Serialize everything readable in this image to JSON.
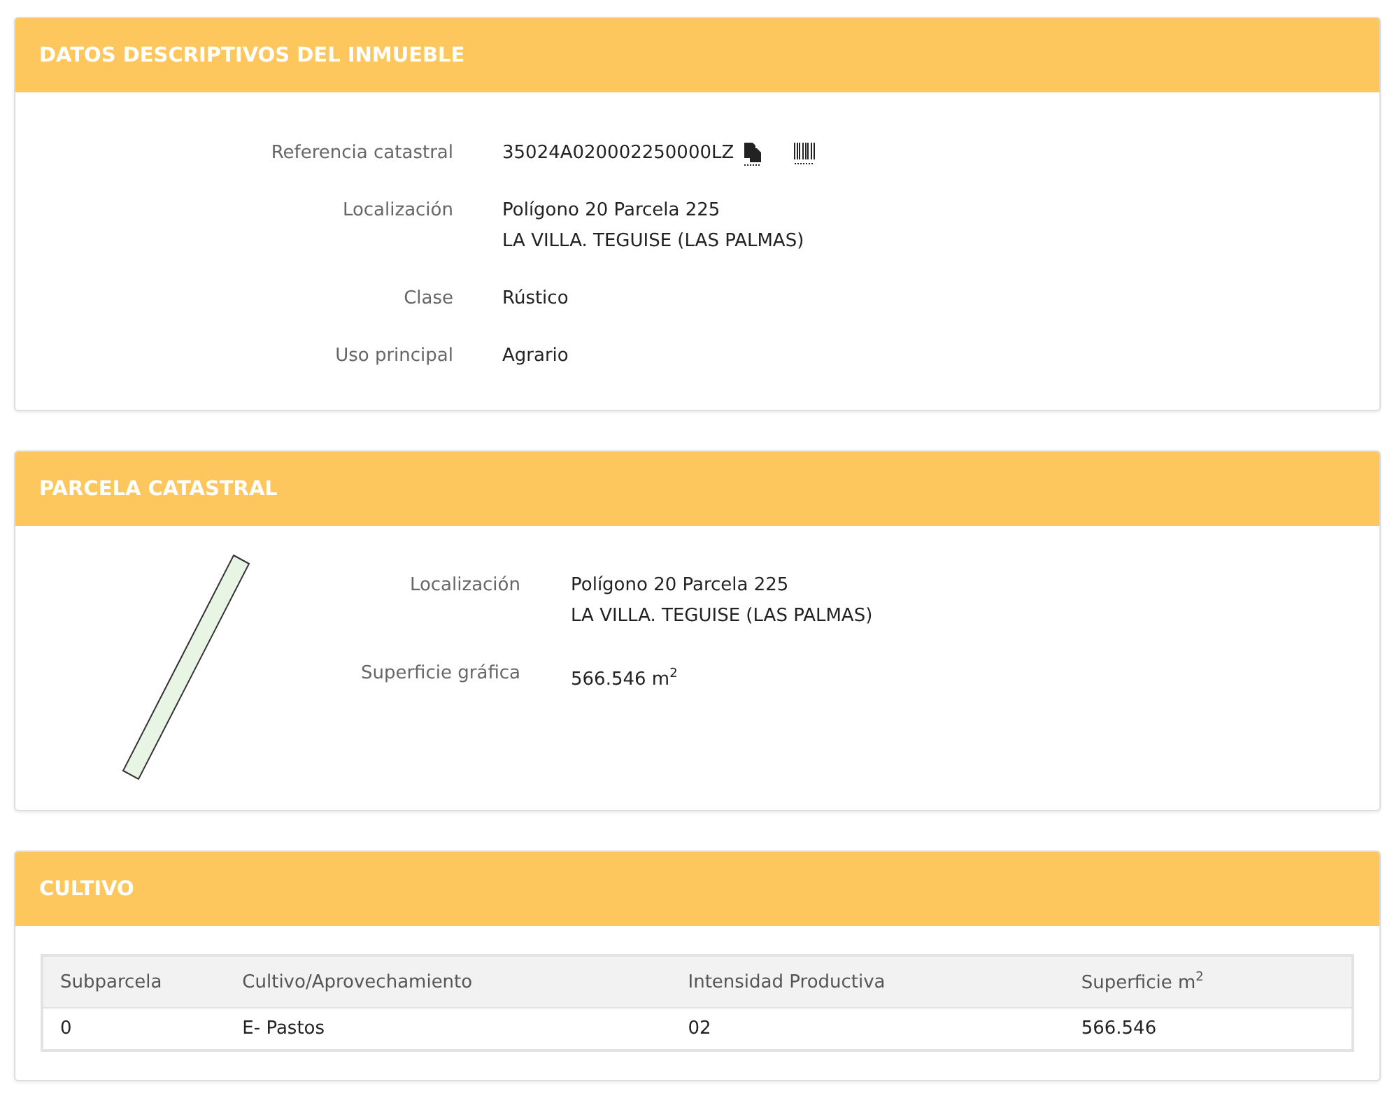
{
  "sections": [
    {
      "kind": "details",
      "title": "DATOS DESCRIPTIVOS DEL INMUEBLE",
      "fields": [
        {
          "kind": "reference",
          "label": "Referencia catastral",
          "lines": [
            "35024A020002250000LZ"
          ]
        },
        {
          "kind": "text",
          "label": "Localización",
          "lines": [
            "Polígono 20 Parcela 225",
            "LA VILLA. TEGUISE (LAS PALMAS)"
          ]
        },
        {
          "kind": "text",
          "label": "Clase",
          "lines": [
            "Rústico"
          ]
        },
        {
          "kind": "text",
          "label": "Uso principal",
          "lines": [
            "Agrario"
          ]
        }
      ]
    },
    {
      "kind": "parcel",
      "title": "PARCELA CATASTRAL",
      "fields": [
        {
          "kind": "text",
          "label": "Localización",
          "lines": [
            "Polígono 20 Parcela 225",
            "LA VILLA. TEGUISE (LAS PALMAS)"
          ]
        },
        {
          "kind": "text",
          "label": "Superficie gráfica",
          "lines": [
            "566.546 m$^{2}$"
          ]
        }
      ]
    },
    {
      "kind": "table",
      "title": "CULTIVO",
      "columns": [
        "Subparcela",
        "Cultivo/Aprovechamiento",
        "Intensidad Productiva",
        "Superficie m$^{2}$"
      ],
      "rows": [
        [
          "0",
          "E- Pastos",
          "02",
          "566.546"
        ]
      ]
    }
  ]
}
